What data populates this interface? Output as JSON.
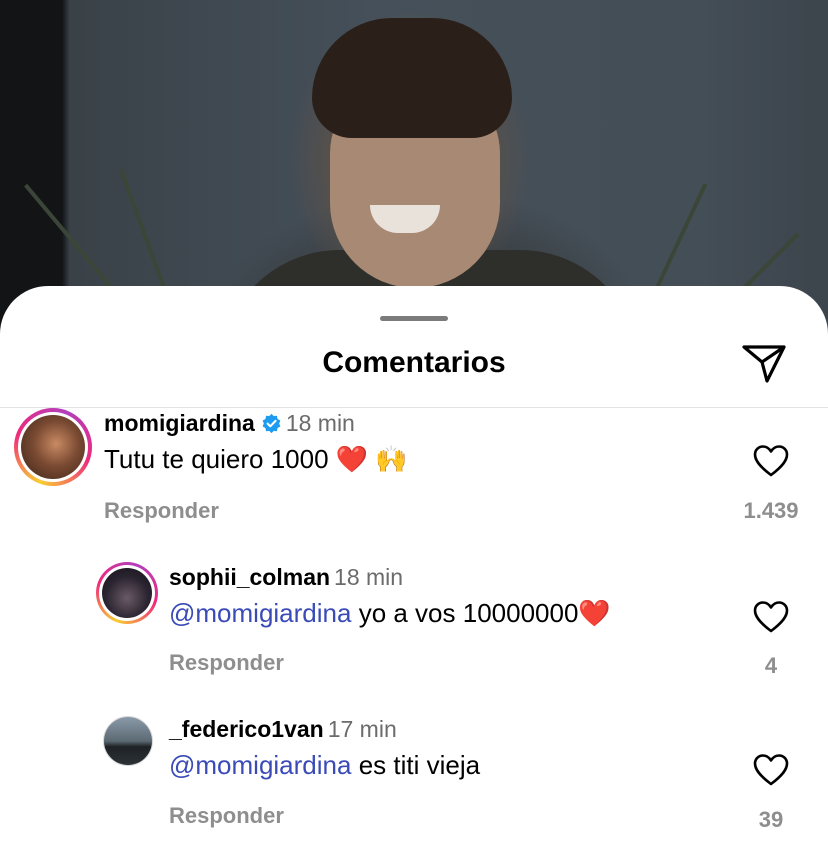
{
  "sheet": {
    "title": "Comentarios",
    "share_icon": "send-icon"
  },
  "comments": [
    {
      "username": "momigiardina",
      "verified": true,
      "time": "18 min",
      "text": "Tutu te quiero 1000 ❤️ 🙌",
      "mention": "",
      "reply_label": "Responder",
      "likes": "1.439"
    },
    {
      "username": "sophii_colman",
      "verified": false,
      "time": "18 min",
      "mention": "@momigiardina",
      "text": " yo a vos 10000000❤️",
      "reply_label": "Responder",
      "likes": "4"
    },
    {
      "username": "_federico1van",
      "verified": false,
      "time": "17 min",
      "mention": "@momigiardina",
      "text": " es titi vieja",
      "reply_label": "Responder",
      "likes": "39"
    }
  ],
  "colors": {
    "mention": "#3a4bb8",
    "secondary_text": "#8e8e8e",
    "verified_badge": "#1d9bf0"
  }
}
